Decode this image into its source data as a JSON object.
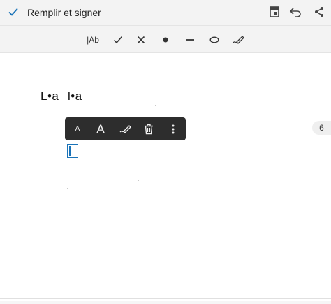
{
  "header": {
    "title": "Remplir et signer",
    "icons": [
      "check-icon",
      "document-icon",
      "undo-icon",
      "share-icon"
    ]
  },
  "toolbar": {
    "text_tool_label": "|Ab",
    "tools": [
      "text-tool",
      "checkmark-tool",
      "cross-tool",
      "dot-tool",
      "line-tool",
      "ellipse-tool",
      "sign-tool"
    ]
  },
  "document": {
    "initials_left": "L•a",
    "initials_right": "l•a"
  },
  "context_menu": {
    "small_a_label": "A",
    "large_a_label": "A",
    "icons": [
      "pen-icon",
      "trash-icon",
      "more-vertical-icon"
    ]
  },
  "page_indicator": {
    "number": "6"
  },
  "colors": {
    "accent": "#1a73b8",
    "bar_bg": "#f3f3f3",
    "menu_bg": "#2d2d2d"
  }
}
